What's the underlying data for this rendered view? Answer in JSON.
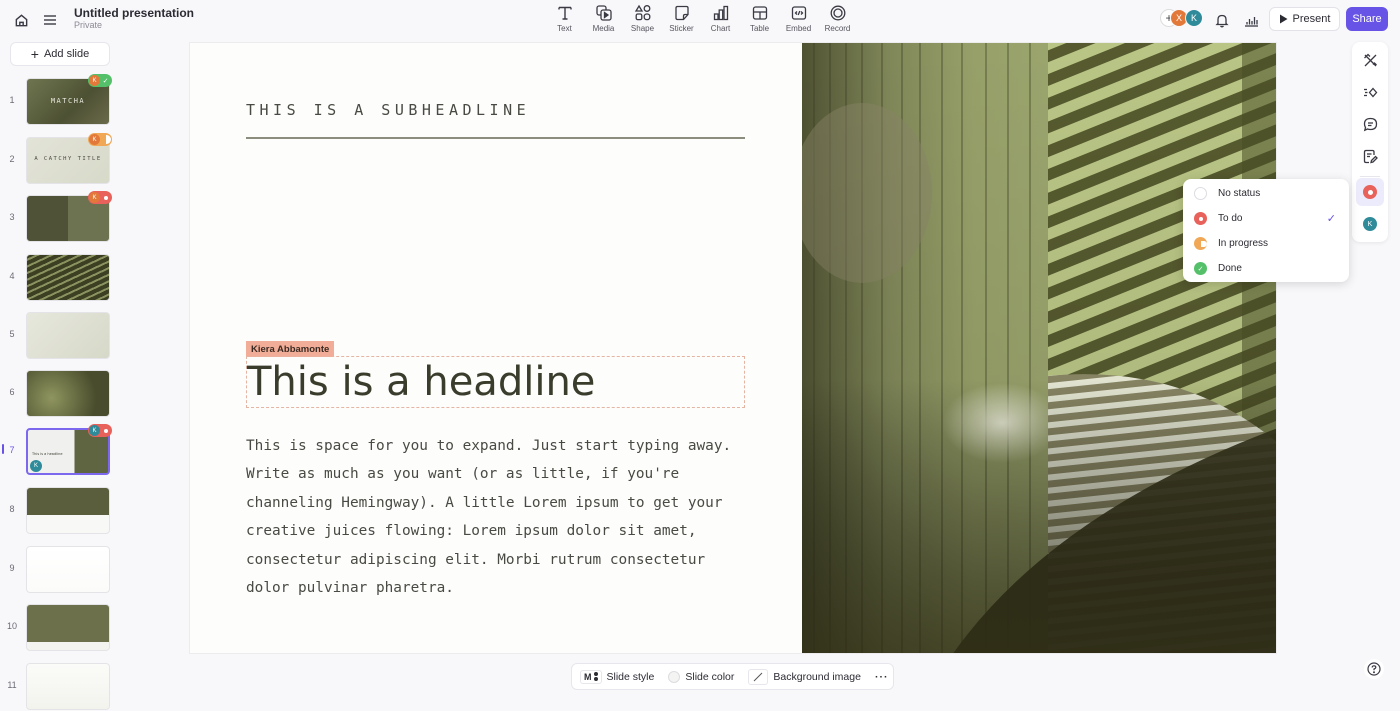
{
  "header": {
    "home_icon": "home-icon",
    "menu_icon": "hamburger-menu-icon",
    "title": "Untitled presentation",
    "visibility": "Private"
  },
  "toolbar": {
    "items": [
      {
        "label": "Text",
        "icon": "text-icon"
      },
      {
        "label": "Media",
        "icon": "media-icon"
      },
      {
        "label": "Shape",
        "icon": "shape-icon"
      },
      {
        "label": "Sticker",
        "icon": "sticker-icon"
      },
      {
        "label": "Chart",
        "icon": "chart-icon"
      },
      {
        "label": "Table",
        "icon": "table-icon"
      },
      {
        "label": "Embed",
        "icon": "embed-icon"
      },
      {
        "label": "Record",
        "icon": "record-icon"
      }
    ]
  },
  "collaborators": {
    "add_symbol": "+",
    "users": [
      {
        "initial": "X",
        "color": "#e2793b"
      },
      {
        "initial": "K",
        "color": "#2f8b9a"
      }
    ]
  },
  "actions": {
    "present_label": "Present",
    "share_label": "Share"
  },
  "sidebar": {
    "add_slide_label": "Add slide",
    "active_index": 7,
    "slides": [
      {
        "number": "1",
        "thumb_text": "MATCHA",
        "badge_user": "K",
        "status": "done"
      },
      {
        "number": "2",
        "thumb_text": "A CATCHY TITLE",
        "badge_user": "K",
        "status": "in_progress"
      },
      {
        "number": "3",
        "thumb_text": "",
        "badge_user": "K",
        "status": "todo"
      },
      {
        "number": "4",
        "thumb_text": "",
        "badge_user": "",
        "status": ""
      },
      {
        "number": "5",
        "thumb_text": "",
        "badge_user": "",
        "status": ""
      },
      {
        "number": "6",
        "thumb_text": "",
        "badge_user": "",
        "status": ""
      },
      {
        "number": "7",
        "thumb_text": "This is a headline",
        "badge_user": "K",
        "status": "todo"
      },
      {
        "number": "8",
        "thumb_text": "",
        "badge_user": "",
        "status": ""
      },
      {
        "number": "9",
        "thumb_text": "",
        "badge_user": "",
        "status": ""
      },
      {
        "number": "10",
        "thumb_text": "",
        "badge_user": "",
        "status": ""
      },
      {
        "number": "11",
        "thumb_text": "",
        "badge_user": "",
        "status": ""
      }
    ]
  },
  "slide": {
    "subheadline": "THIS IS A SUBHEADLINE",
    "author_tag": "Kiera Abbamonte",
    "headline": "This is a headline",
    "body": "This is space for you to expand. Just start typing away. Write as much as you want (or as little, if you're channeling Hemingway). A little Lorem ipsum to get your creative juices flowing: Lorem ipsum dolor sit amet, consectetur adipiscing elit. Morbi rutrum consectetur dolor pulvinar pharetra."
  },
  "right_rail": {
    "items": [
      "design-tools-icon",
      "animation-icon",
      "comment-icon",
      "notes-icon",
      "status-icon",
      "assignee-avatar"
    ],
    "assignee_initial": "K"
  },
  "status_menu": {
    "selected": "To do",
    "options": [
      {
        "label": "No status",
        "color": "#ffffff"
      },
      {
        "label": "To do",
        "color": "#e8615a"
      },
      {
        "label": "In progress",
        "color": "#f0a856"
      },
      {
        "label": "Done",
        "color": "#55c06a"
      }
    ]
  },
  "bottom_bar": {
    "slide_style_label": "Slide style",
    "slide_style_glyph": "M",
    "slide_color_label": "Slide color",
    "background_image_label": "Background image",
    "more_label": "···"
  },
  "colors": {
    "accent": "#6753e6",
    "slide_text": "#3a3d2c",
    "author_tag": "#f1ad97"
  }
}
